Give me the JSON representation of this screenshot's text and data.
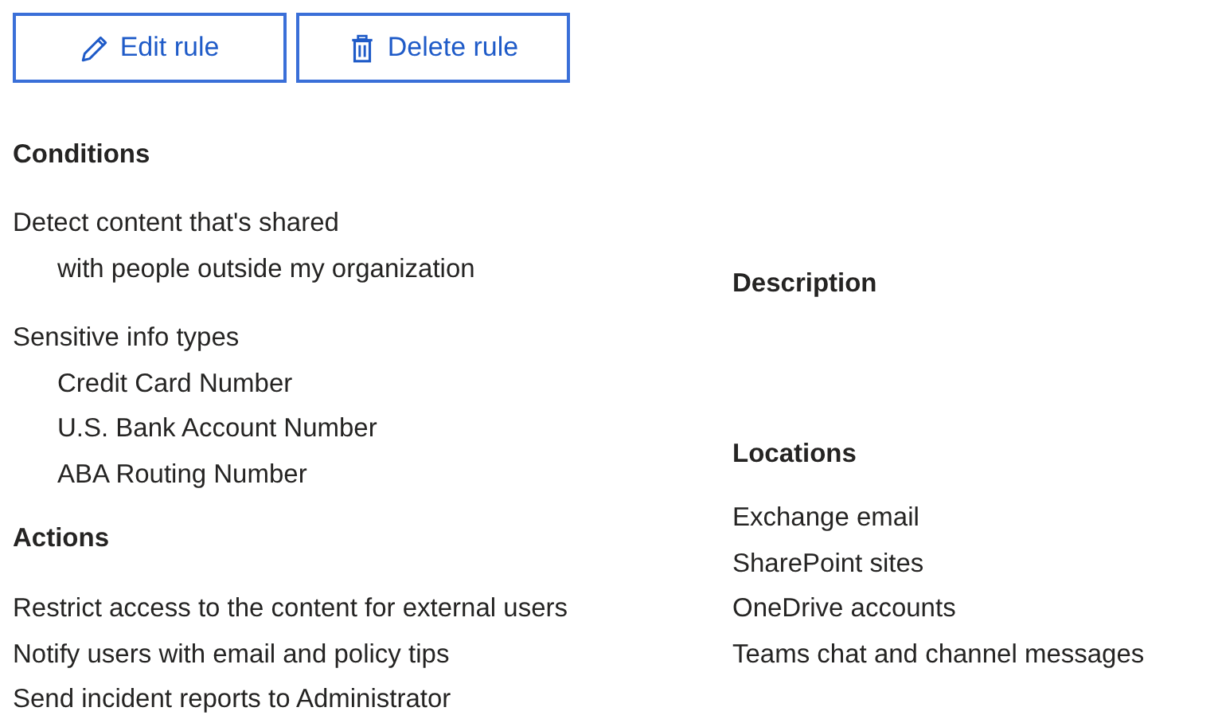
{
  "buttons": [
    {
      "label": "Edit rule",
      "kind": "edit"
    },
    {
      "label": "Delete rule",
      "kind": "delete"
    }
  ],
  "conditions": {
    "heading": "Conditions",
    "groups": [
      {
        "title": "Detect content that's shared",
        "items": [
          "with people outside my organization"
        ]
      },
      {
        "title": "Sensitive info types",
        "items": [
          "Credit Card Number",
          "U.S. Bank Account Number",
          "ABA Routing Number"
        ]
      }
    ]
  },
  "actions": {
    "heading": "Actions",
    "items": [
      "Restrict access to the content for external users",
      "Notify users with email and policy tips",
      "Send incident reports to Administrator"
    ]
  },
  "description": {
    "heading": "Description"
  },
  "locations": {
    "heading": "Locations",
    "items": [
      "Exchange email",
      "SharePoint sites",
      "OneDrive accounts",
      "Teams chat and channel messages"
    ]
  }
}
